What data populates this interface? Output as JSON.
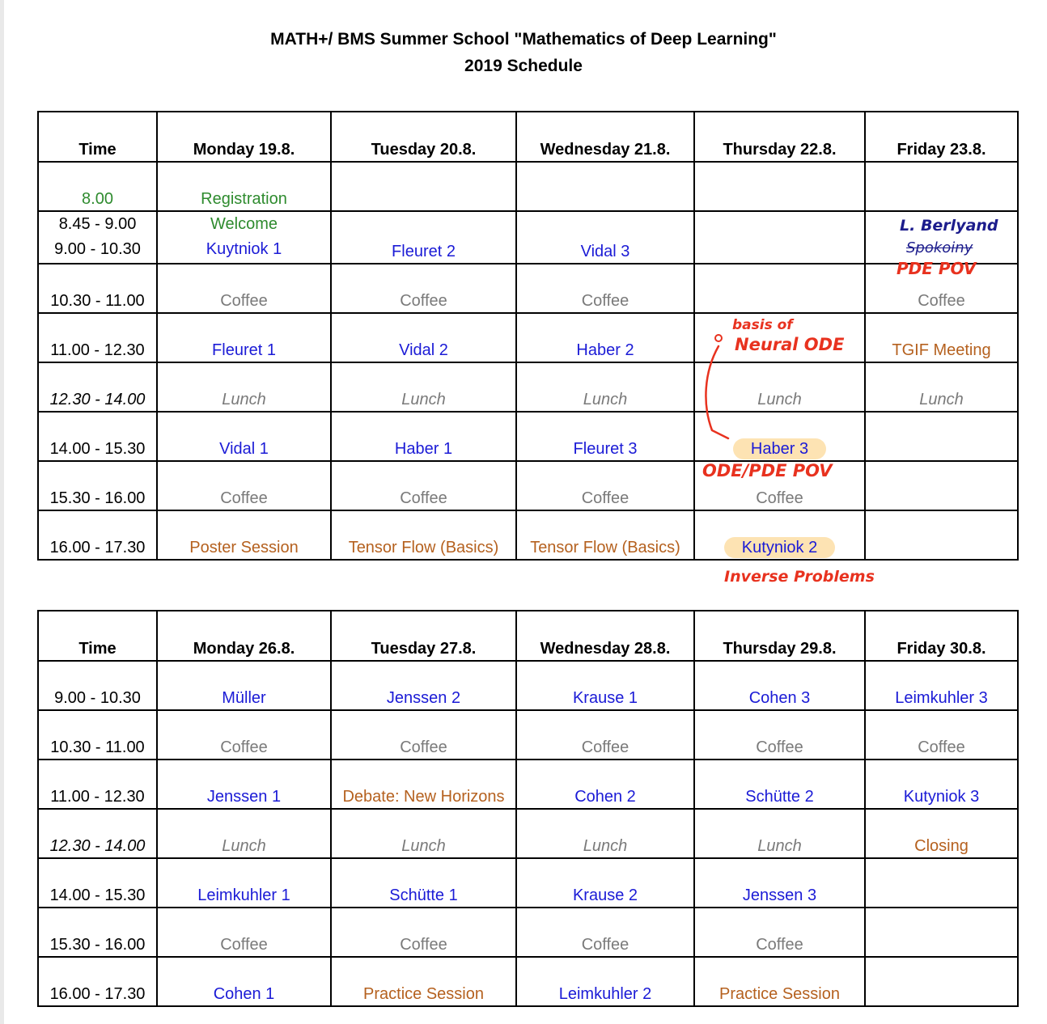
{
  "title": {
    "line1": "MATH+/ BMS Summer School \"Mathematics of Deep Learning\"",
    "line2": "2019 Schedule"
  },
  "week1": {
    "headers": [
      "Time",
      "Monday 19.8.",
      "Tuesday 20.8.",
      "Wednesday 21.8.",
      "Thursday 22.8.",
      "Friday 23.8."
    ],
    "rows": [
      {
        "time": [
          "8.00"
        ],
        "cells": [
          [
            "Registration"
          ],
          [
            ""
          ],
          [
            ""
          ],
          [
            ""
          ],
          [
            ""
          ]
        ]
      },
      {
        "time": [
          "8.45 - 9.00",
          "9.00 - 10.30"
        ],
        "cells": [
          [
            "Welcome",
            "Kuytniok 1"
          ],
          [
            "",
            "Fleuret 2"
          ],
          [
            "",
            "Vidal 3"
          ],
          [
            "",
            ""
          ],
          [
            "",
            ""
          ]
        ]
      },
      {
        "time": [
          "10.30 - 11.00"
        ],
        "cells": [
          [
            "Coffee"
          ],
          [
            "Coffee"
          ],
          [
            "Coffee"
          ],
          [
            ""
          ],
          [
            "Coffee"
          ]
        ]
      },
      {
        "time": [
          "11.00 - 12.30"
        ],
        "cells": [
          [
            "Fleuret 1"
          ],
          [
            "Vidal 2"
          ],
          [
            "Haber 2"
          ],
          [
            ""
          ],
          [
            "TGIF Meeting"
          ]
        ]
      },
      {
        "time": [
          "12.30 - 14.00"
        ],
        "cells": [
          [
            "Lunch"
          ],
          [
            "Lunch"
          ],
          [
            "Lunch"
          ],
          [
            "Lunch"
          ],
          [
            "Lunch"
          ]
        ]
      },
      {
        "time": [
          "14.00 - 15.30"
        ],
        "cells": [
          [
            "Vidal 1"
          ],
          [
            "Haber 1"
          ],
          [
            "Fleuret 3"
          ],
          [
            "Haber 3"
          ],
          [
            ""
          ]
        ]
      },
      {
        "time": [
          "15.30 - 16.00"
        ],
        "cells": [
          [
            "Coffee"
          ],
          [
            "Coffee"
          ],
          [
            "Coffee"
          ],
          [
            "Coffee"
          ],
          [
            ""
          ]
        ]
      },
      {
        "time": [
          "16.00 - 17.30"
        ],
        "cells": [
          [
            "Poster Session"
          ],
          [
            "Tensor Flow (Basics)"
          ],
          [
            "Tensor Flow (Basics)"
          ],
          [
            "Kutyniok 2"
          ],
          [
            ""
          ]
        ]
      }
    ]
  },
  "week2": {
    "headers": [
      "Time",
      "Monday 26.8.",
      "Tuesday 27.8.",
      "Wednesday 28.8.",
      "Thursday 29.8.",
      "Friday 30.8."
    ],
    "rows": [
      {
        "time": [
          "9.00 - 10.30"
        ],
        "cells": [
          [
            "Müller"
          ],
          [
            "Jenssen 2"
          ],
          [
            "Krause 1"
          ],
          [
            "Cohen 3"
          ],
          [
            "Leimkuhler 3"
          ]
        ]
      },
      {
        "time": [
          "10.30 - 11.00"
        ],
        "cells": [
          [
            "Coffee"
          ],
          [
            "Coffee"
          ],
          [
            "Coffee"
          ],
          [
            "Coffee"
          ],
          [
            "Coffee"
          ]
        ]
      },
      {
        "time": [
          "11.00 - 12.30"
        ],
        "cells": [
          [
            "Jenssen 1"
          ],
          [
            "Debate: New Horizons"
          ],
          [
            "Cohen 2"
          ],
          [
            "Schütte 2"
          ],
          [
            "Kutyniok 3"
          ]
        ]
      },
      {
        "time": [
          "12.30 - 14.00"
        ],
        "cells": [
          [
            "Lunch"
          ],
          [
            "Lunch"
          ],
          [
            "Lunch"
          ],
          [
            "Lunch"
          ],
          [
            "Closing"
          ]
        ]
      },
      {
        "time": [
          "14.00 - 15.30"
        ],
        "cells": [
          [
            "Leimkuhler 1"
          ],
          [
            "Schütte 1"
          ],
          [
            "Krause 2"
          ],
          [
            "Jenssen 3"
          ],
          [
            ""
          ]
        ]
      },
      {
        "time": [
          "15.30 - 16.00"
        ],
        "cells": [
          [
            "Coffee"
          ],
          [
            "Coffee"
          ],
          [
            "Coffee"
          ],
          [
            "Coffee"
          ],
          [
            ""
          ]
        ]
      },
      {
        "time": [
          "16.00 - 17.30"
        ],
        "cells": [
          [
            "Cohen 1"
          ],
          [
            "Practice Session"
          ],
          [
            "Leimkuhler 2"
          ],
          [
            "Practice Session"
          ],
          [
            ""
          ]
        ]
      }
    ]
  },
  "annotations": {
    "friday_name": "L. Berlyand",
    "friday_struck": "Spokoiny",
    "friday_pov": "PDE POV",
    "thursday_top_line1": "basis of",
    "thursday_top_line2": "Neural ODE",
    "thursday_mid": "ODE/PDE POV",
    "thursday_bottom": "Inverse Problems"
  },
  "colors": {
    "registration": "#2e8b2e",
    "lecture": "#1b1bd6",
    "coffee": "#7a7a7a",
    "event": "#b5611f",
    "highlight": "#fde3b3",
    "annotation_red": "#e8321f",
    "annotation_navy": "#1c1c8c"
  }
}
